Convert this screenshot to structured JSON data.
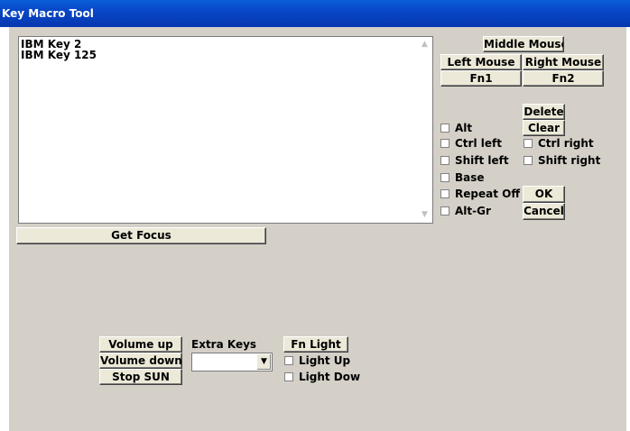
{
  "window": {
    "title": "Key Macro Tool"
  },
  "listbox": {
    "items": [
      "IBM Key 2",
      "IBM Key 125"
    ]
  },
  "buttons": {
    "middle_mouse": "Middle Mouse",
    "left_mouse": "Left Mouse",
    "right_mouse": "Right Mouse",
    "fn1": "Fn1",
    "fn2": "Fn2",
    "delete": "Delete",
    "clear": "Clear",
    "ok": "OK",
    "cancel": "Cancel",
    "get_focus": "Get Focus",
    "volume_up": "Volume up",
    "volume_down": "Volume down",
    "stop_sun": "Stop SUN",
    "fn_light": "Fn Light"
  },
  "checkboxes": {
    "alt": "Alt",
    "ctrl_left": "Ctrl left",
    "shift_left": "Shift left",
    "base": "Base",
    "repeat_off": "Repeat Off",
    "alt_gr": "Alt-Gr",
    "ctrl_right": "Ctrl right",
    "shift_right": "Shift right",
    "light_up": "Light Up",
    "light_down": "Light Dow"
  },
  "extra_keys": {
    "label": "Extra Keys",
    "selected": ""
  },
  "colors": {
    "titlebar": "#0846c6",
    "face": "#d4d0c8",
    "button": "#ece9d8"
  }
}
